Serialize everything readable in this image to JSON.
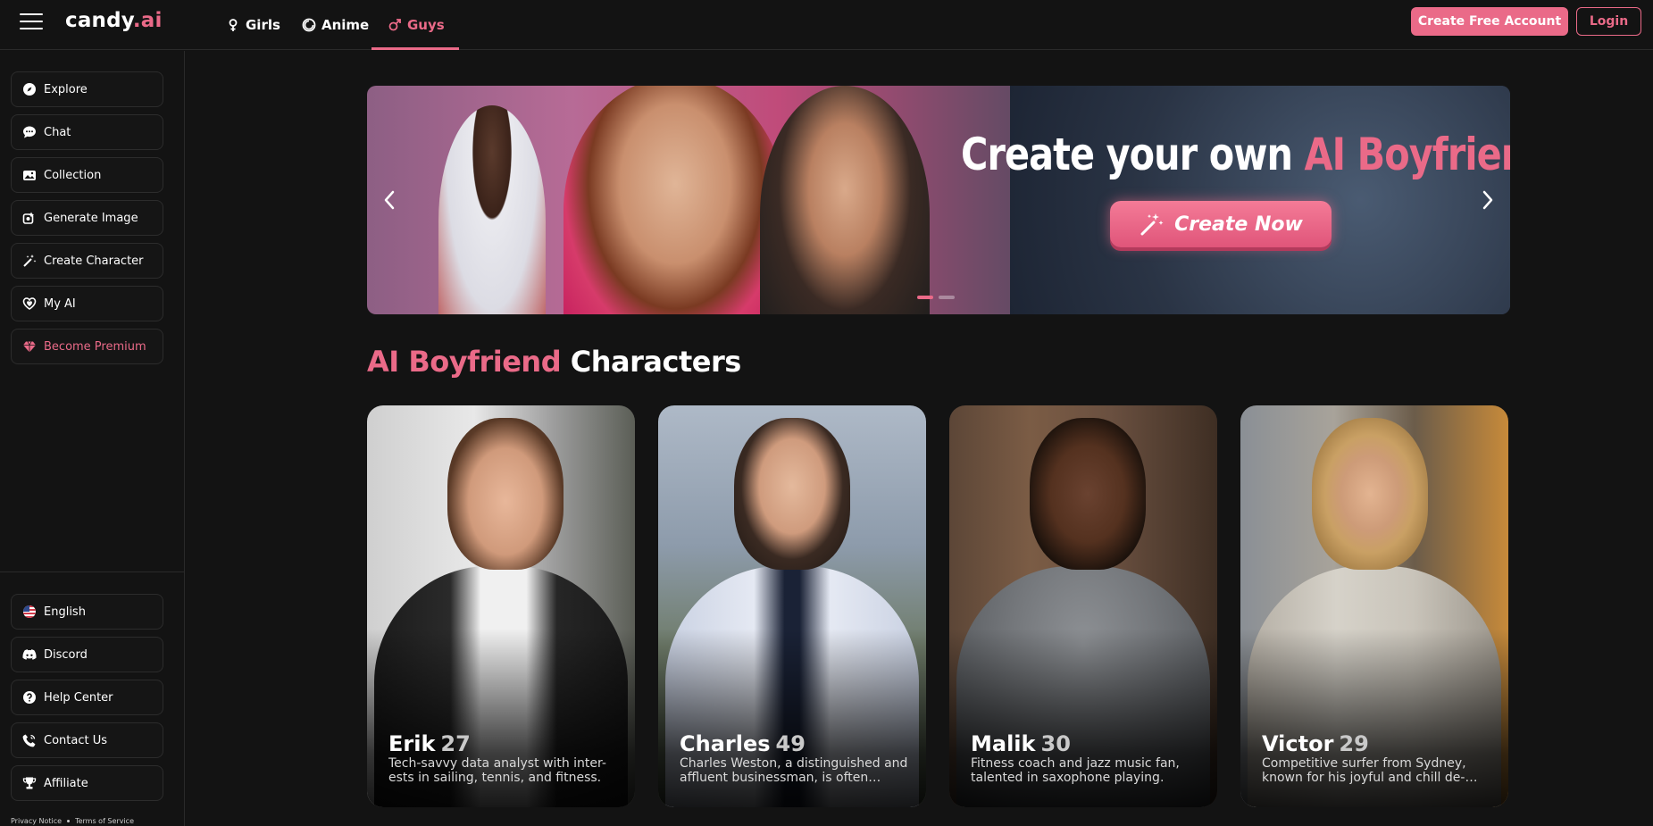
{
  "header": {
    "logo_main": "candy",
    "logo_accent": ".ai",
    "tabs": [
      {
        "label": "Girls",
        "icon": "female-icon"
      },
      {
        "label": "Anime",
        "icon": "anime-icon"
      },
      {
        "label": "Guys",
        "icon": "male-icon",
        "active": true
      }
    ],
    "create_account_label": "Create Free Account",
    "login_label": "Login"
  },
  "sidebar": {
    "items": [
      {
        "label": "Explore",
        "icon": "compass-icon"
      },
      {
        "label": "Chat",
        "icon": "chat-icon"
      },
      {
        "label": "Collection",
        "icon": "collection-icon"
      },
      {
        "label": "Generate Image",
        "icon": "image-icon"
      },
      {
        "label": "Create Character",
        "icon": "magic-wand-icon"
      },
      {
        "label": "My AI",
        "icon": "hearts-icon"
      },
      {
        "label": "Become Premium",
        "icon": "diamond-icon"
      }
    ],
    "bottom_items": [
      {
        "label": "English",
        "icon": "us-flag-icon"
      },
      {
        "label": "Discord",
        "icon": "discord-icon"
      },
      {
        "label": "Help Center",
        "icon": "help-icon"
      },
      {
        "label": "Contact Us",
        "icon": "phone-icon"
      },
      {
        "label": "Affiliate",
        "icon": "trophy-icon"
      }
    ],
    "footer": {
      "privacy": "Privacy Notice",
      "terms": "Terms of Service"
    }
  },
  "banner": {
    "title_main": "Create your own",
    "title_accent": "AI Boyfriend",
    "button_label": "Create Now",
    "slide_count": 2,
    "active_slide": 1
  },
  "section": {
    "title_accent": "AI Boyfriend",
    "title_main": "Characters"
  },
  "characters": [
    {
      "name": "Erik",
      "age": "27",
      "description": "Tech-savvy data analyst with inter-ests in sailing, tennis, and fitness."
    },
    {
      "name": "Charles",
      "age": "49",
      "description": "Charles Weston, a distinguished and affluent businessman, is often…"
    },
    {
      "name": "Malik",
      "age": "30",
      "description": "Fitness coach and jazz music fan, talented in saxophone playing."
    },
    {
      "name": "Victor",
      "age": "29",
      "description": "Competitive surfer from Sydney, known for his joyful and chill de-…"
    }
  ],
  "colors": {
    "accent": "#ea6a88",
    "background": "#131313",
    "border": "#2a2a2a"
  }
}
